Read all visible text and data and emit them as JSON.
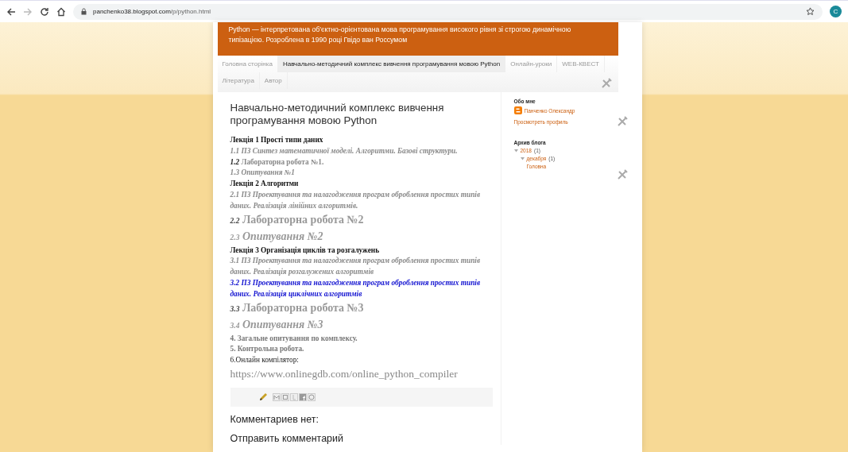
{
  "browser": {
    "url_host": "panchenko38.blogspot.com",
    "url_path": "/p/python.html",
    "back_disabled": false,
    "forward_disabled": true,
    "avatar": "C"
  },
  "header": {
    "description": "Python — інтерпретована об'єктно-орієнтована мова програмування високого рівня зі строгою динамічною типізацією. Розроблена в 1990 році Гвідо ван Россумом"
  },
  "tab_rows": [
    [
      {
        "label": "Головна сторінка",
        "selected": false
      },
      {
        "label": "Навчально-методичний комплекс вивчення програмування мовою Python",
        "selected": true
      },
      {
        "label": "Онлайн-уроки",
        "selected": false
      },
      {
        "label": "WEB-КВЕСТ",
        "selected": false
      }
    ],
    [
      {
        "label": "Література",
        "selected": false
      },
      {
        "label": "Автор",
        "selected": false
      }
    ]
  ],
  "post": {
    "title": "Навчально-методичний комплекс вивчення програмування мовою Python",
    "lines": [
      {
        "kind": "lecture",
        "text": "Лекція 1 Прості типи даних"
      },
      {
        "kind": "italic",
        "text": "1.1 ПЗ Синтез математичної моделі. Алгоритми. Базові структури."
      },
      {
        "kind": "lab",
        "number": "1.2",
        "text": "Лабораторна робота №1."
      },
      {
        "kind": "italic",
        "text": "1.3 Опитування №1"
      },
      {
        "kind": "lecture",
        "text": "Лекція 2 Алгоритми"
      },
      {
        "kind": "italic",
        "text": "2.1 ПЗ Проектування та налагодження програм оброблення простих типів даних. Реалізація лінійних алгоритмів."
      },
      {
        "kind": "big",
        "number": "2.2",
        "text": "Лабораторна робота №2"
      },
      {
        "kind": "big-italic",
        "number": "2.3",
        "text": "Опитування №2"
      },
      {
        "kind": "lecture",
        "text": "Лекція 3 Організація циклів та розгалужень"
      },
      {
        "kind": "italic",
        "text": "3.1 ПЗ Проектування та налагодження програм оброблення простих типів даних. Реалізація розгалужених алгоритмів"
      },
      {
        "kind": "link",
        "text": "3.2 ПЗ Проектування та налагодження програм оброблення простих типів даних. Реалізація циклічних алгоритмів"
      },
      {
        "kind": "big",
        "number": "3.3",
        "text": "Лабораторна робота №3"
      },
      {
        "kind": "big-italic",
        "number": "3.4",
        "text": "Опитування №3"
      },
      {
        "kind": "bold-grey",
        "text": "4. Загальне опитування по комплексу."
      },
      {
        "kind": "bold-grey",
        "text": "5. Контрольна робота."
      },
      {
        "kind": "plain",
        "text": "6.Онлайн компілятор:"
      },
      {
        "kind": "url",
        "text": "https://www.onlinegdb.com/online_python_compiler"
      }
    ]
  },
  "comments": {
    "heading": "Комментариев нет:",
    "post_comment": "Отправить комментарий"
  },
  "sidebar": {
    "about_heading": "Обо мне",
    "author": "Панченко Олександр",
    "profile_link": "Просмотреть профиль",
    "archive_heading": "Архив блога",
    "archive": [
      {
        "label": "2018",
        "count": "(1)",
        "expanded": true,
        "children": [
          {
            "label": "декабря",
            "count": "(1)",
            "expanded": true,
            "children": [
              {
                "label": "Головна"
              }
            ]
          }
        ]
      }
    ]
  }
}
